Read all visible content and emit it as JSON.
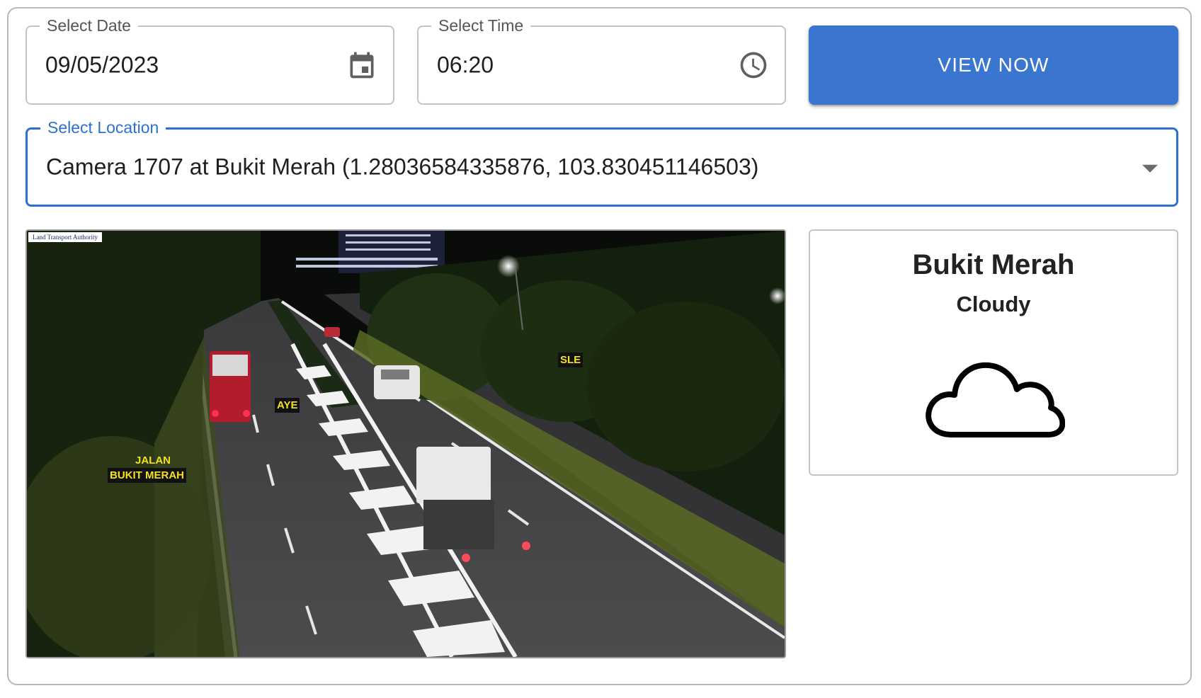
{
  "date_picker": {
    "label": "Select Date",
    "value": "09/05/2023",
    "icon": "calendar-icon"
  },
  "time_picker": {
    "label": "Select Time",
    "value": "06:20",
    "icon": "clock-icon"
  },
  "view_button": {
    "label": "VIEW NOW",
    "color": "#3a76d0"
  },
  "location_select": {
    "label": "Select Location",
    "value": "Camera 1707 at Bukit Merah (1.28036584335876, 103.830451146503)",
    "accent": "#2f6fd0"
  },
  "camera_image": {
    "watermark": "Land Transport Authority",
    "road_labels": [
      "SLE",
      "AYE",
      "JALAN",
      "BUKIT MERAH"
    ]
  },
  "weather": {
    "area": "Bukit Merah",
    "condition": "Cloudy",
    "icon": "cloud-icon"
  }
}
